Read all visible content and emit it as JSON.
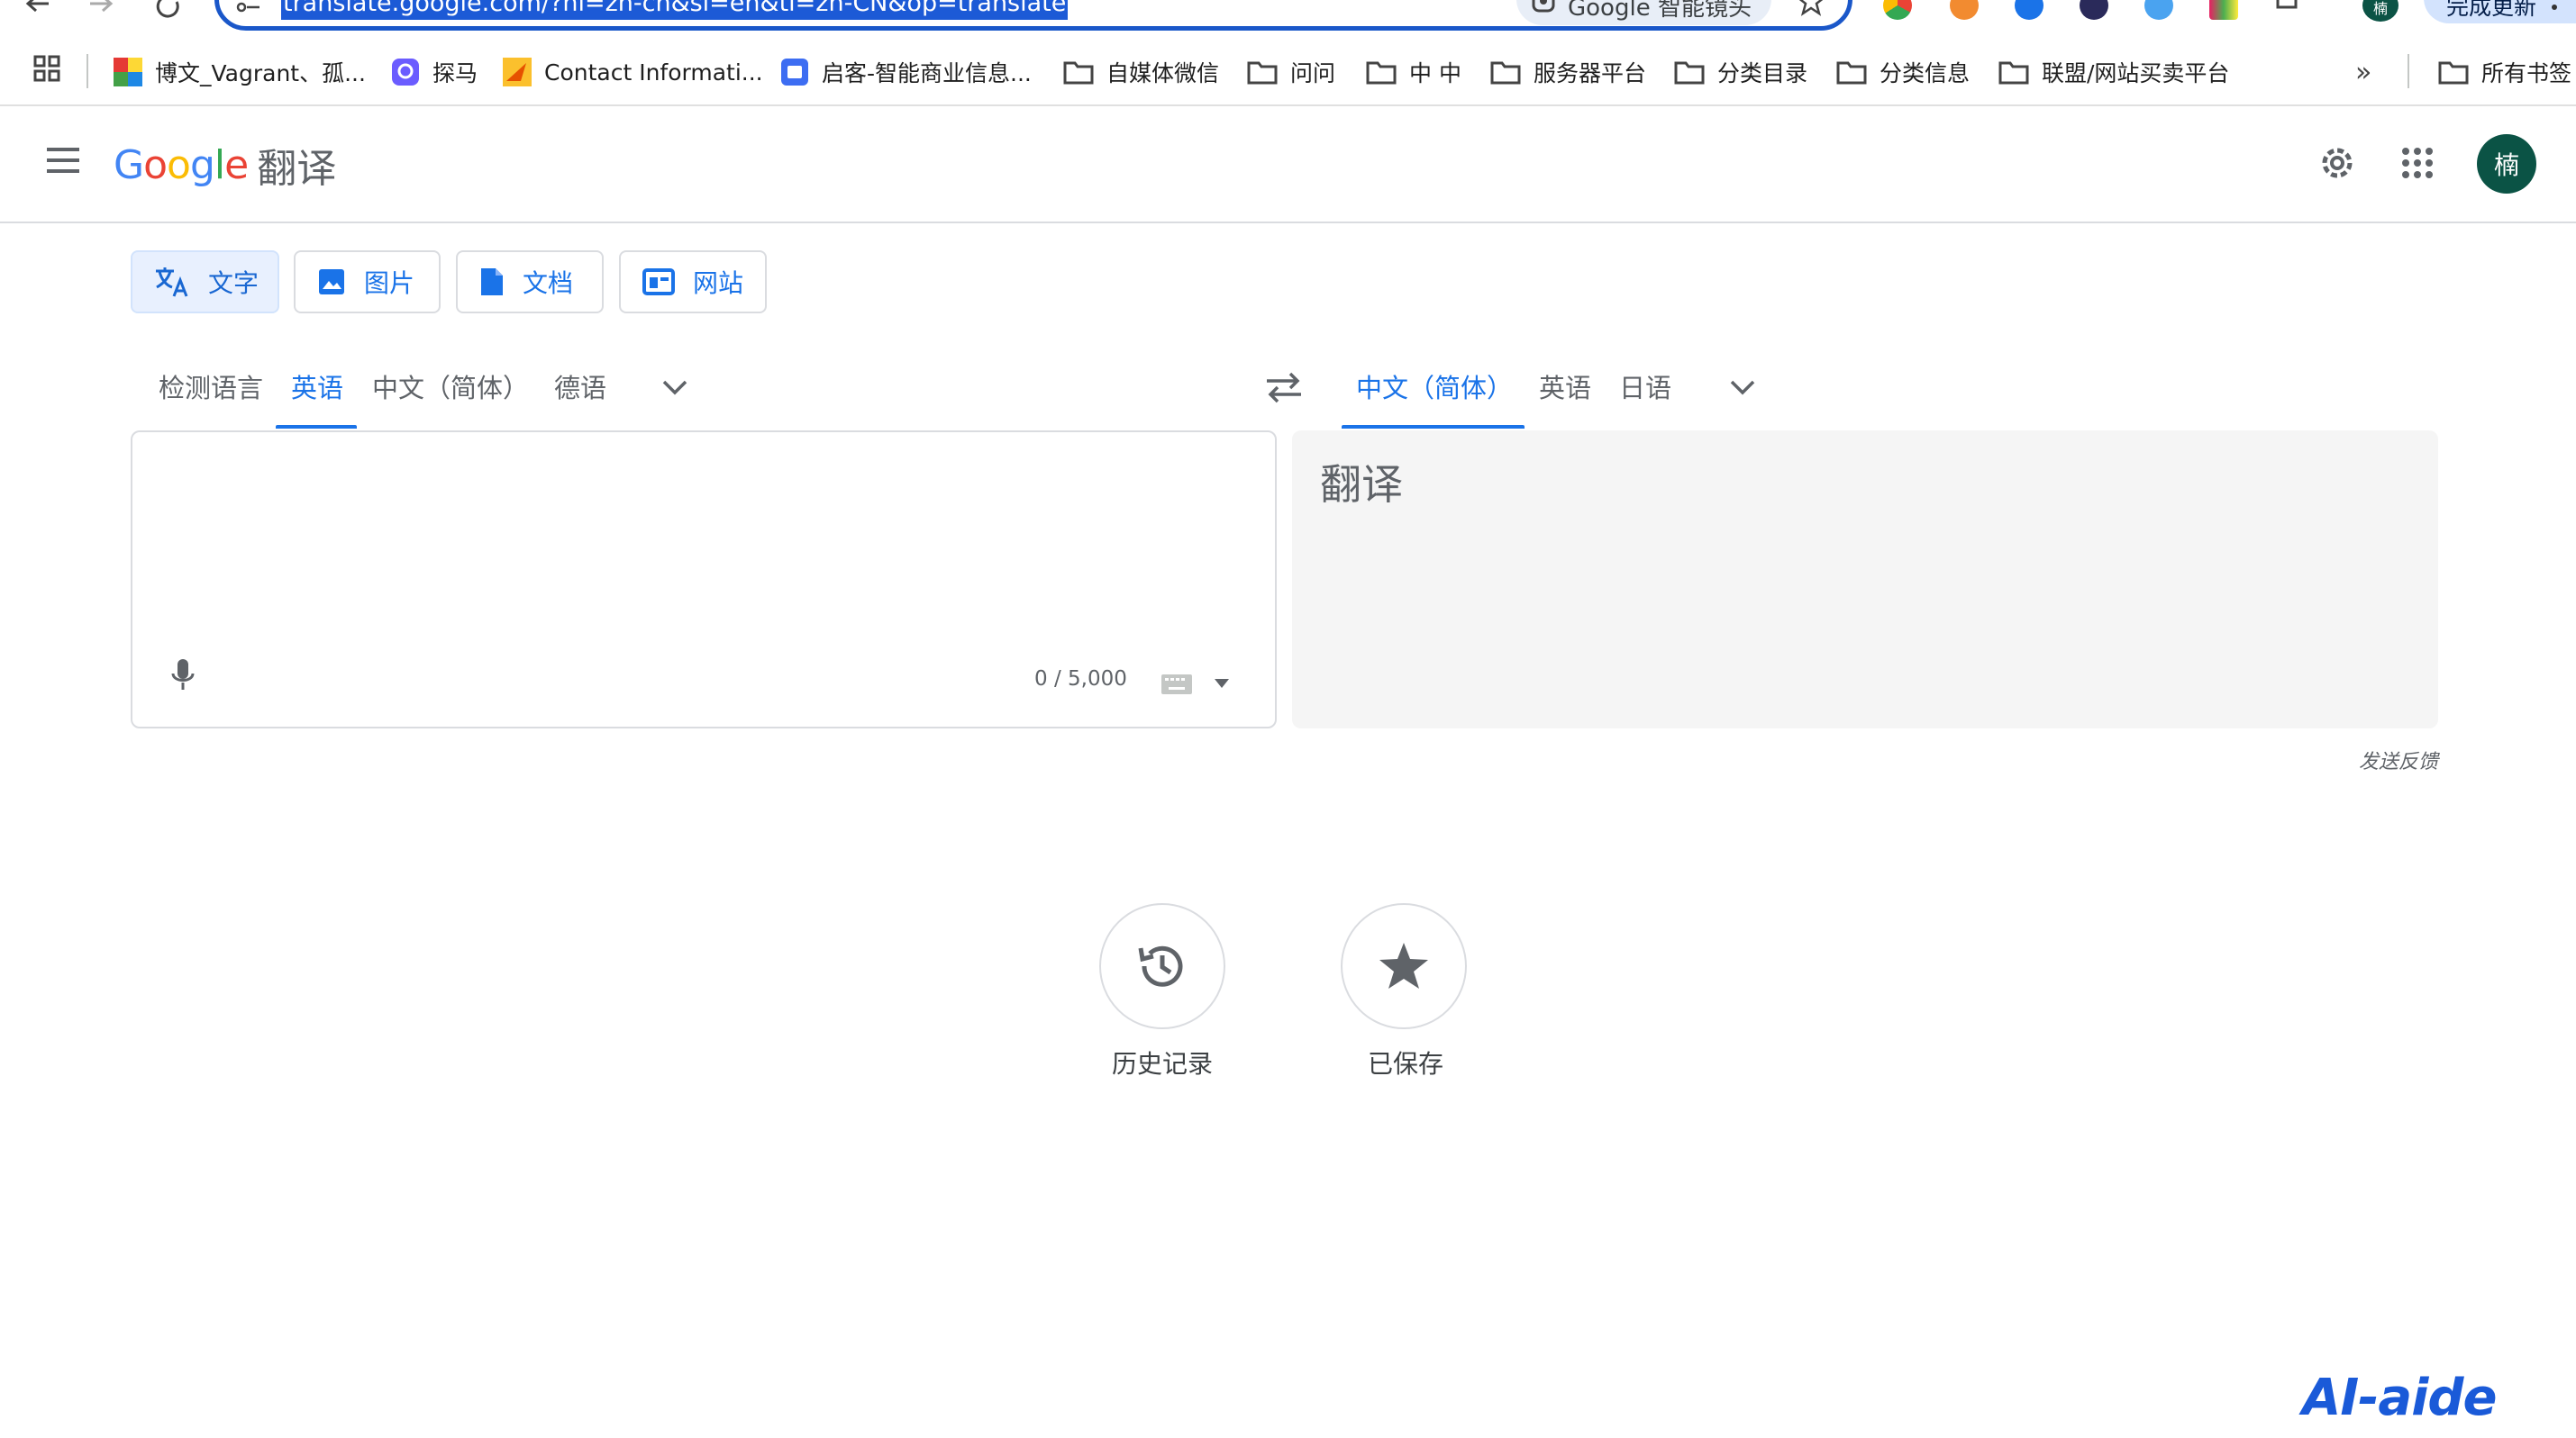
{
  "browser": {
    "url": "translate.google.com/?hl=zh-cn&sl=en&tl=zh-CN&op=translate",
    "lens_label": "Google 智能镜头",
    "update_label": "完成更新",
    "profile_initial": "楠"
  },
  "bookmarks": {
    "items": [
      {
        "label": "博文_Vagrant、孤...",
        "icon": "colorful-site-icon"
      },
      {
        "label": "探马",
        "icon": "purple-app-icon"
      },
      {
        "label": "Contact Informati...",
        "icon": "yellow-site-icon"
      },
      {
        "label": "启客-智能商业信息...",
        "icon": "blue-app-icon"
      },
      {
        "label": "自媒体微信",
        "icon": "folder-icon"
      },
      {
        "label": "问问",
        "icon": "folder-icon"
      },
      {
        "label": "中 中",
        "icon": "folder-icon"
      },
      {
        "label": "服务器平台",
        "icon": "folder-icon"
      },
      {
        "label": "分类目录",
        "icon": "folder-icon"
      },
      {
        "label": "分类信息",
        "icon": "folder-icon"
      },
      {
        "label": "联盟/网站买卖平台",
        "icon": "folder-icon"
      }
    ],
    "more": "»",
    "all_bookmarks": "所有书签"
  },
  "header": {
    "logo_google": "Google",
    "logo_product": "翻译",
    "avatar_initial": "楠"
  },
  "modes": [
    {
      "label": "文字",
      "icon": "translate-icon",
      "active": true
    },
    {
      "label": "图片",
      "icon": "image-icon",
      "active": false
    },
    {
      "label": "文档",
      "icon": "document-icon",
      "active": false
    },
    {
      "label": "网站",
      "icon": "website-icon",
      "active": false
    }
  ],
  "source_languages": [
    "检测语言",
    "英语",
    "中文（简体）",
    "德语"
  ],
  "source_selected": "英语",
  "target_languages": [
    "中文（简体）",
    "英语",
    "日语"
  ],
  "target_selected": "中文（简体）",
  "source": {
    "value": "",
    "char_count": "0 / 5,000"
  },
  "target": {
    "placeholder": "翻译"
  },
  "feedback_label": "发送反馈",
  "actions": {
    "history": "历史记录",
    "saved": "已保存"
  },
  "watermark": "AI-aide",
  "colors": {
    "accent": "#1a73e8",
    "avatar_bg": "#0b5345",
    "url_highlight": "#1c5ad6"
  }
}
